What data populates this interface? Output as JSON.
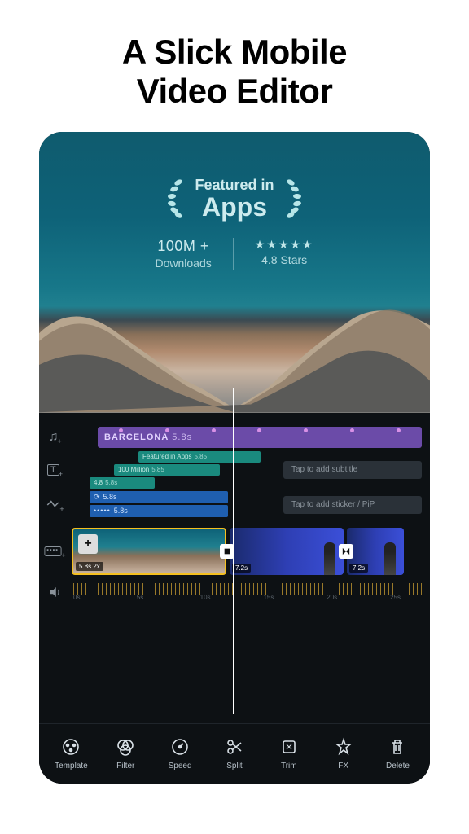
{
  "title": "A Slick Mobile\nVideo Editor",
  "featured": {
    "line1": "Featured in",
    "line2": "Apps"
  },
  "stats": {
    "downloads_value": "100M +",
    "downloads_label": "Downloads",
    "rating_stars": "★★★★★",
    "rating_label": "4.8 Stars"
  },
  "tracks": {
    "music": {
      "title": "BARCELONA",
      "time": "5.8s"
    },
    "text_clips": [
      {
        "text": "Featured in Apps",
        "time": "5.85"
      },
      {
        "text": "100 Million",
        "time": "5.85"
      },
      {
        "text": "4.8",
        "time": "5.8s"
      }
    ],
    "subtitle_placeholder": "Tap to add subtitle",
    "blue_clips": [
      {
        "icon": "⟳",
        "time": "5.8s"
      },
      {
        "icon": "•••••",
        "time": "5.8s"
      }
    ],
    "sticker_placeholder": "Tap to add sticker / PiP"
  },
  "clips": [
    {
      "duration": "5.8s",
      "speed": "2x",
      "selected": true
    },
    {
      "duration": "7.2s",
      "selected": false
    },
    {
      "duration": "7.2s",
      "selected": false
    }
  ],
  "ruler": [
    "0s",
    "",
    "5s",
    "",
    "10s",
    "",
    "15s",
    "",
    "20s",
    "",
    "25s"
  ],
  "toolbar": [
    {
      "id": "template",
      "label": "Template"
    },
    {
      "id": "filter",
      "label": "Filter"
    },
    {
      "id": "speed",
      "label": "Speed"
    },
    {
      "id": "split",
      "label": "Split"
    },
    {
      "id": "trim",
      "label": "Trim"
    },
    {
      "id": "fx",
      "label": "FX"
    },
    {
      "id": "delete",
      "label": "Delete"
    }
  ]
}
